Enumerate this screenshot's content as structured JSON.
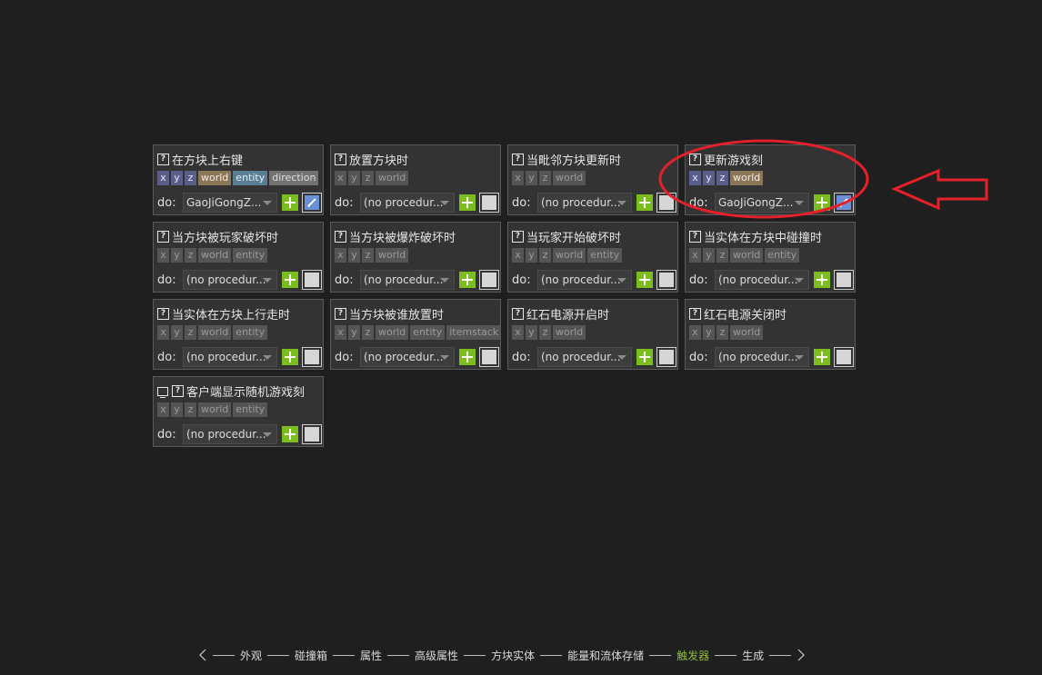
{
  "labels": {
    "do": "do:"
  },
  "triggers": [
    {
      "title": "在方块上右键",
      "client_icon": false,
      "params": [
        "x",
        "y",
        "z",
        "world",
        "entity",
        "direction"
      ],
      "procedure": "GaoJiGongZ...",
      "active": true,
      "edit_enabled": true
    },
    {
      "title": "放置方块时",
      "client_icon": false,
      "params": [
        "x",
        "y",
        "z",
        "world"
      ],
      "procedure": "(no procedur...",
      "active": false,
      "edit_enabled": false
    },
    {
      "title": "当毗邻方块更新时",
      "client_icon": false,
      "params": [
        "x",
        "y",
        "z",
        "world"
      ],
      "procedure": "(no procedur...",
      "active": false,
      "edit_enabled": false
    },
    {
      "title": "更新游戏刻",
      "client_icon": false,
      "params": [
        "x",
        "y",
        "z",
        "world"
      ],
      "procedure": "GaoJiGongZ...",
      "active": true,
      "edit_enabled": true
    },
    {
      "title": "当方块被玩家破坏时",
      "client_icon": false,
      "params": [
        "x",
        "y",
        "z",
        "world",
        "entity"
      ],
      "procedure": "(no procedur...",
      "active": false,
      "edit_enabled": false
    },
    {
      "title": "当方块被爆炸破坏时",
      "client_icon": false,
      "params": [
        "x",
        "y",
        "z",
        "world"
      ],
      "procedure": "(no procedur...",
      "active": false,
      "edit_enabled": false
    },
    {
      "title": "当玩家开始破坏时",
      "client_icon": false,
      "params": [
        "x",
        "y",
        "z",
        "world",
        "entity"
      ],
      "procedure": "(no procedur...",
      "active": false,
      "edit_enabled": false
    },
    {
      "title": "当实体在方块中碰撞时",
      "client_icon": false,
      "params": [
        "x",
        "y",
        "z",
        "world",
        "entity"
      ],
      "procedure": "(no procedur...",
      "active": false,
      "edit_enabled": false
    },
    {
      "title": "当实体在方块上行走时",
      "client_icon": false,
      "params": [
        "x",
        "y",
        "z",
        "world",
        "entity"
      ],
      "procedure": "(no procedur...",
      "active": false,
      "edit_enabled": false
    },
    {
      "title": "当方块被谁放置时",
      "client_icon": false,
      "params": [
        "x",
        "y",
        "z",
        "world",
        "entity",
        "itemstack"
      ],
      "procedure": "(no procedur...",
      "active": false,
      "edit_enabled": false
    },
    {
      "title": "红石电源开启时",
      "client_icon": false,
      "params": [
        "x",
        "y",
        "z",
        "world"
      ],
      "procedure": "(no procedur...",
      "active": false,
      "edit_enabled": false
    },
    {
      "title": "红石电源关闭时",
      "client_icon": false,
      "params": [
        "x",
        "y",
        "z",
        "world"
      ],
      "procedure": "(no procedur...",
      "active": false,
      "edit_enabled": false
    },
    {
      "title": "客户端显示随机游戏刻",
      "client_icon": true,
      "params": [
        "x",
        "y",
        "z",
        "world",
        "entity"
      ],
      "procedure": "(no procedur...",
      "active": false,
      "edit_enabled": false
    }
  ],
  "nav": {
    "prev_icon": "chevron-left-icon",
    "next_icon": "chevron-right-icon",
    "items": [
      {
        "label": "外观",
        "active": false
      },
      {
        "label": "碰撞箱",
        "active": false
      },
      {
        "label": "属性",
        "active": false
      },
      {
        "label": "高级属性",
        "active": false
      },
      {
        "label": "方块实体",
        "active": false
      },
      {
        "label": "能量和流体存储",
        "active": false
      },
      {
        "label": "触发器",
        "active": true
      },
      {
        "label": "生成",
        "active": false
      }
    ]
  },
  "annotation_color": "#e4202a",
  "colors": {
    "add_button": "#7cbd1e",
    "edit_button_active": "#6b8fd6",
    "nav_active": "#8fb83a"
  }
}
